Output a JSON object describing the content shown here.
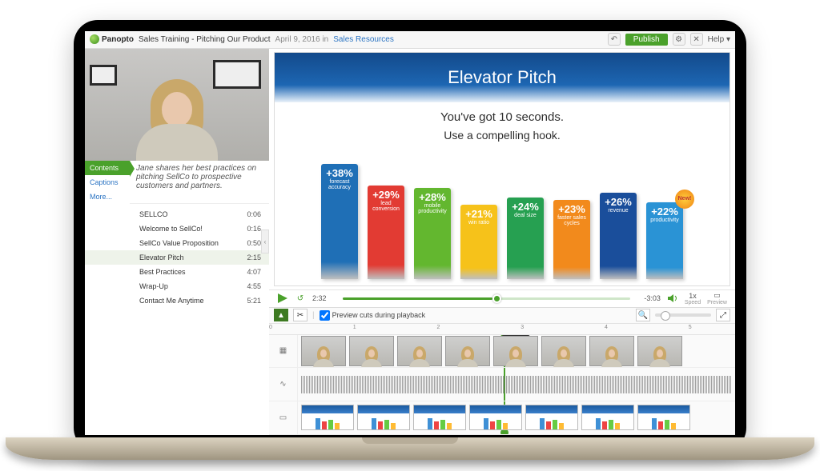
{
  "header": {
    "brand": "Panopto",
    "title": "Sales Training - Pitching Our Product",
    "date": "April 9, 2016 in",
    "category_link": "Sales Resources",
    "publish": "Publish",
    "help": "Help"
  },
  "sidebar": {
    "tabs": {
      "contents": "Contents",
      "captions": "Captions",
      "more": "More..."
    },
    "description": "Jane shares her best practices on pitching SellCo to prospective customers and partners.",
    "toc": [
      {
        "label": "SELLCO",
        "time": "0:06"
      },
      {
        "label": "Welcome to SellCo!",
        "time": "0:16"
      },
      {
        "label": "SellCo Value Proposition",
        "time": "0:50"
      },
      {
        "label": "Elevator Pitch",
        "time": "2:15"
      },
      {
        "label": "Best Practices",
        "time": "4:07"
      },
      {
        "label": "Wrap-Up",
        "time": "4:55"
      },
      {
        "label": "Contact Me Anytime",
        "time": "5:21"
      }
    ],
    "current_index": 3
  },
  "slide": {
    "title": "Elevator Pitch",
    "line1": "You've got 10 seconds.",
    "line2": "Use a compelling hook.",
    "badge": "New!"
  },
  "player": {
    "elapsed": "2:32",
    "remaining": "-3:03",
    "speed_value": "1x",
    "speed_label": "Speed",
    "preview": "Preview"
  },
  "editor": {
    "preview_cuts": "Preview cuts during playback",
    "ruler": [
      "0",
      "1",
      "2",
      "3",
      "4",
      "5"
    ],
    "clip_timestamp": "2:32.00"
  },
  "chart_data": {
    "type": "bar",
    "title": "Elevator Pitch",
    "ylabel": "",
    "ylim": [
      0,
      40
    ],
    "series": [
      {
        "pct": "+38%",
        "label": "forecast accuracy",
        "value": 38,
        "color": "#1f6fb6"
      },
      {
        "pct": "+29%",
        "label": "lead conversion",
        "value": 29,
        "color": "#e23b33"
      },
      {
        "pct": "+28%",
        "label": "mobile productivity",
        "value": 28,
        "color": "#63b72f"
      },
      {
        "pct": "+21%",
        "label": "win ratio",
        "value": 21,
        "color": "#f6c21a"
      },
      {
        "pct": "+24%",
        "label": "deal size",
        "value": 24,
        "color": "#26a051"
      },
      {
        "pct": "+23%",
        "label": "faster sales cycles",
        "value": 23,
        "color": "#f28a1c"
      },
      {
        "pct": "+26%",
        "label": "revenue",
        "value": 26,
        "color": "#1a4e9b"
      },
      {
        "pct": "+22%",
        "label": "productivity",
        "value": 22,
        "color": "#2a93d5"
      }
    ]
  }
}
